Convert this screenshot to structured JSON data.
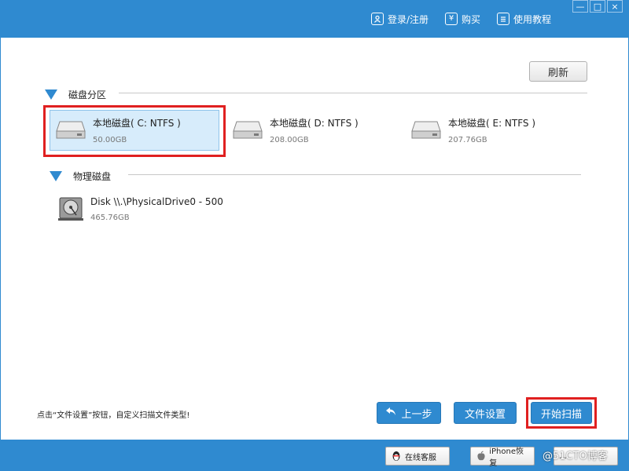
{
  "titlebar": {
    "login_label": "登录/注册",
    "buy_label": "购买",
    "tutorial_label": "使用教程",
    "buy_icon_glyph": "¥",
    "window_buttons": {
      "minimize": "—",
      "maximize": "□",
      "close": "×"
    }
  },
  "toolbar": {
    "refresh_label": "刷新"
  },
  "partitions": {
    "title": "磁盘分区",
    "items": [
      {
        "name": "本地磁盘( C: NTFS )",
        "size": "50.00GB"
      },
      {
        "name": "本地磁盘( D: NTFS )",
        "size": "208.00GB"
      },
      {
        "name": "本地磁盘( E: NTFS )",
        "size": "207.76GB"
      }
    ]
  },
  "physical": {
    "title": "物理磁盘",
    "items": [
      {
        "name": "Disk \\\\.\\PhysicalDrive0 - 500",
        "size": "465.76GB"
      }
    ]
  },
  "hint_text": "点击“文件设置”按钮，自定义扫描文件类型!",
  "actions": {
    "back_label": "上一步",
    "file_settings_label": "文件设置",
    "start_scan_label": "开始扫描"
  },
  "footer": {
    "online_service_label": "在线客服",
    "iphone_recovery_label": "iPhone恢复",
    "third_button_label": "..."
  },
  "watermark": "@51CTO博客",
  "colors": {
    "accent": "#2f8ad0",
    "highlight": "#e02020",
    "selected_bg": "#d7ecfb"
  }
}
